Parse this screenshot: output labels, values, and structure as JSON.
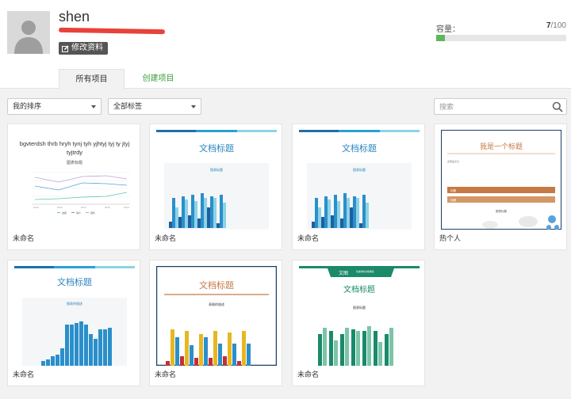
{
  "user": {
    "name": "shen",
    "edit_label": "修改资料"
  },
  "capacity": {
    "label": "容量：",
    "used": "7",
    "total": "/100",
    "fraction": 0.07
  },
  "tabs": {
    "all": "所有项目",
    "create": "创建项目"
  },
  "filters": {
    "sort": "我的排序",
    "tags": "全部标签"
  },
  "search": {
    "placeholder": "搜索"
  },
  "colors": {
    "accent_green": "#5cb85c",
    "tab_green": "#3a9e3a",
    "blue_dark": "#1f6fa8",
    "blue_light": "#63c6d9",
    "orange": "#c57a45",
    "teal": "#1a8a6a"
  },
  "cards": [
    {
      "name": "未命名",
      "thumb": {
        "type": "line-chart",
        "heading": "bgvterdsh thrb hryh tynj tyh yjhtyj tyj ty jtyj tyjtrdy",
        "subtitle": "图表标题",
        "legend": [
          "金额",
          "用户",
          "销售"
        ]
      }
    },
    {
      "name": "未命名",
      "thumb": {
        "type": "bar-chart",
        "title": "文档标题",
        "subtitle": "图表标题"
      }
    },
    {
      "name": "未命名",
      "thumb": {
        "type": "bar-chart",
        "title": "文档标题",
        "subtitle": "图表标题"
      }
    },
    {
      "name": "热个人",
      "thumb": {
        "type": "doc-orange",
        "title": "我是一个标题",
        "body": "这里是正文",
        "bar1": "标题",
        "bar2": "标题",
        "caption": "图表标题"
      }
    },
    {
      "name": "未命名",
      "thumb": {
        "type": "bar-chart-2",
        "title": "文档标题",
        "subtitle": "图表的描述"
      }
    },
    {
      "name": "未命名",
      "thumb": {
        "type": "bar-chart-3",
        "title": "文档标题",
        "subtitle": "表格的描述"
      }
    },
    {
      "name": "未命名",
      "thumb": {
        "type": "bar-chart-4",
        "brand": "文图",
        "brand_sub": "新媒体的文档排版",
        "title": "文档标题",
        "subtitle": "图表标题"
      }
    }
  ]
}
